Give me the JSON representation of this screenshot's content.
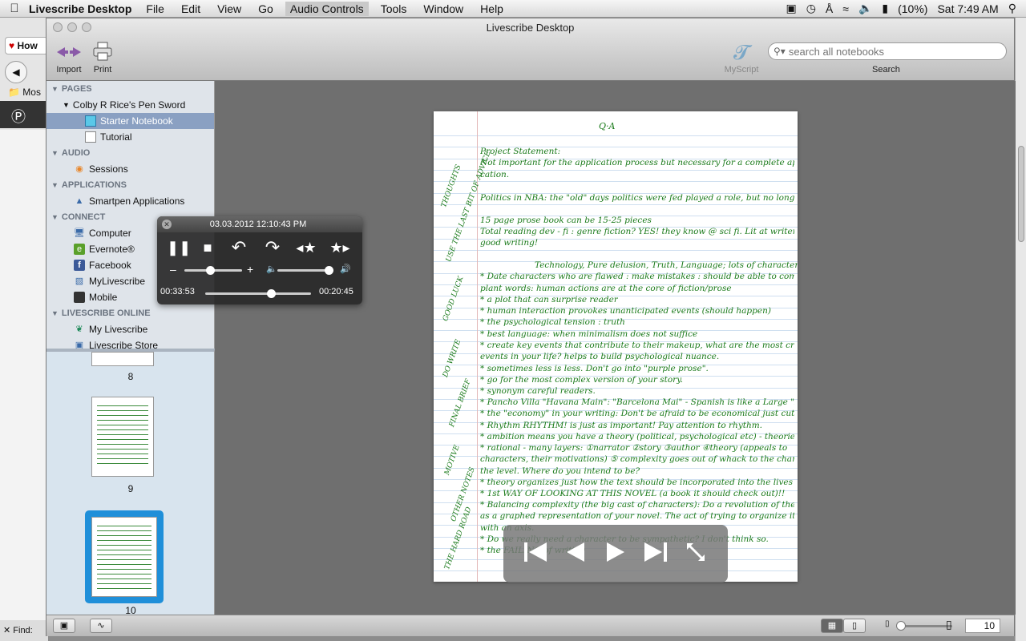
{
  "menubar": {
    "app_name": "Livescribe Desktop",
    "items": [
      "File",
      "Edit",
      "View",
      "Go",
      "Audio Controls",
      "Tools",
      "Window",
      "Help"
    ],
    "battery": "(10%)",
    "clock": "Sat 7:49 AM"
  },
  "background_window": {
    "tab_label": "How",
    "bookmark": "Mos",
    "find_label": "Find:"
  },
  "window": {
    "title": "Livescribe Desktop"
  },
  "toolbar": {
    "import_label": "Import",
    "print_label": "Print",
    "myscript_label": "MyScript",
    "search_placeholder": "search all notebooks",
    "search_label": "Search"
  },
  "sidebar": {
    "pages_header": "PAGES",
    "pen_name": "Colby R Rice's Pen Sword",
    "notebooks": [
      "Starter Notebook",
      "Tutorial"
    ],
    "audio_header": "AUDIO",
    "audio_items": [
      "Sessions"
    ],
    "applications_header": "APPLICATIONS",
    "application_items": [
      "Smartpen Applications"
    ],
    "connect_header": "CONNECT",
    "connect_items": [
      "Computer",
      "Evernote®",
      "Facebook",
      "MyLivescribe",
      "Mobile"
    ],
    "online_header": "LIVESCRIBE ONLINE",
    "online_items": [
      "My Livescribe",
      "Livescribe Store"
    ]
  },
  "thumbnails": {
    "labels": [
      "8",
      "9",
      "10"
    ],
    "selected": "10"
  },
  "audio_player": {
    "timestamp": "03.03.2012 12:10:43 PM",
    "elapsed": "00:33:53",
    "remaining": "00:20:45",
    "speed_fraction": 0.45,
    "volume_fraction": 1.0,
    "progress_fraction": 0.62
  },
  "notebook_page": {
    "title": "Q·A",
    "lines": [
      "Project Statement:",
      "Not important for the application process but necessary for a complete appl-",
      "cation.",
      "Politics in NBA: the \"old\" days politics were fed played a role, but no longer.",
      "15 page prose book can be 15-25 pieces",
      "Total reading dev - fi : genre fiction? YES! they know @ sci fi. Lit at writers in",
      "good writing!",
      "Technology, Pure delusion, Truth, Language; lots of characters",
      "* Date characters who are flawed : make mistakes : should be able to commit errors",
      "plant words: human actions are at the core of fiction/prose",
      "* a plot that can surprise reader",
      "* human interaction provokes unanticipated events (should happen)",
      "* the psychological tension : truth",
      "* best language: when minimalism does not suffice",
      "* create key events that contribute to their makeup, what are the most crucial",
      "events in your life? helps to build psychological nuance.",
      "* sometimes less is less. Don't go into \"purple prose\".",
      "* go for the most complex version of your story.",
      "* synonym careful readers.",
      "* Pancho Villa \"Havana Main\": \"Barcelona Mai\" - Spanish is like a Large \"Big\" English!",
      "* the \"economy\" in your writing: Don't be afraid to be economical just cut.",
      "* Rhythm RHYTHM! is just as important! Pay attention to rhythm.",
      "* ambition means you have a theory (political, psychological etc) - theories are not",
      "* rational - many layers: ①narrator ②story ③author ④theory (appeals to",
      "characters, their motivations) ⑤ complexity goes out of whack to the character",
      "the level. Where do you intend to be?",
      "* theory organizes just how the text should be incorporated into the lives of your novel",
      "* 1st WAY OF LOOKING AT THIS NOVEL (a book it should check out)!!",
      "* Balancing complexity (the big cast of characters): Do a revolution of the book",
      "as a graphed representation of your novel. The act of trying to organize it is done",
      "with an axis.",
      "* Do we really need a character to be sympathetic? I don't think so.",
      "* the FAILING of writing"
    ],
    "margin_notes": [
      "THOUGHTS",
      "USE THE LAST BIT OF ADVICE",
      "GOOD LUCK",
      "DO WRITE",
      "FINAL BRIEF",
      "MOTIVE",
      "OTHER NOTES",
      "THE HARD ROAD"
    ]
  },
  "pager": {
    "page_number": "10"
  }
}
